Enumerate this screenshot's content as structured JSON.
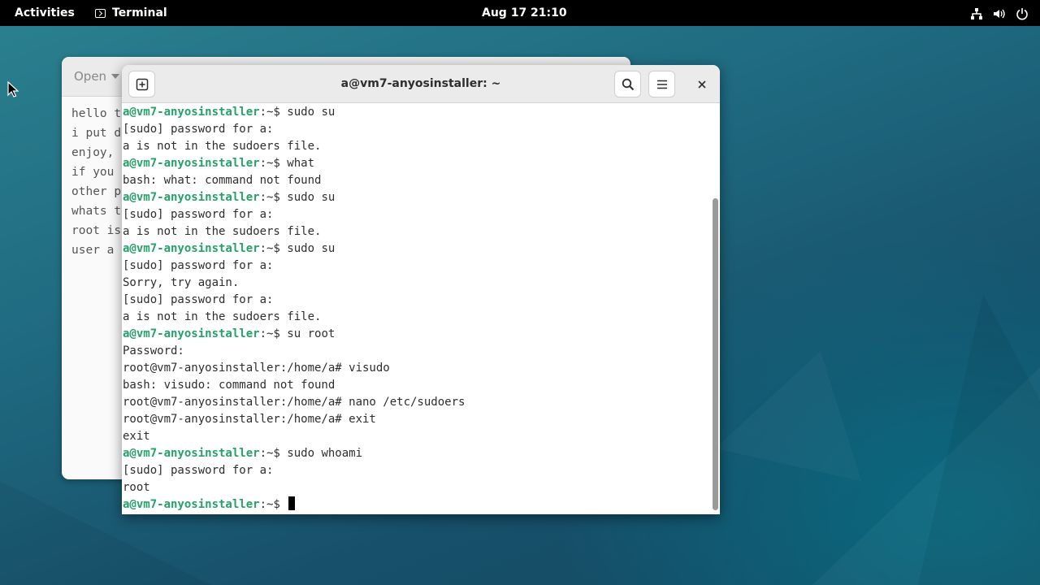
{
  "topbar": {
    "activities": "Activities",
    "app_name": "Terminal",
    "clock": "Aug 17  21:10"
  },
  "tray_icons": [
    "network-icon",
    "volume-icon",
    "power-icon"
  ],
  "editor": {
    "open_label": "Open",
    "lines": [
      "hello t",
      "i put d",
      "enjoy,",
      "if you",
      "other p",
      "whats t",
      "root is",
      "user a"
    ]
  },
  "terminal": {
    "title": "a@vm7-anyosinstaller: ~",
    "prompt_user": "a@vm7-anyosinstaller",
    "prompt_suffix": ":~$ ",
    "lines": [
      {
        "type": "prompt",
        "text": "sudo su"
      },
      {
        "type": "out",
        "text": "[sudo] password for a:"
      },
      {
        "type": "out",
        "text": "a is not in the sudoers file."
      },
      {
        "type": "prompt",
        "text": "what"
      },
      {
        "type": "out",
        "text": "bash: what: command not found"
      },
      {
        "type": "prompt",
        "text": "sudo su"
      },
      {
        "type": "out",
        "text": "[sudo] password for a:"
      },
      {
        "type": "out",
        "text": "a is not in the sudoers file."
      },
      {
        "type": "prompt",
        "text": "sudo su"
      },
      {
        "type": "out",
        "text": "[sudo] password for a:"
      },
      {
        "type": "out",
        "text": "Sorry, try again."
      },
      {
        "type": "out",
        "text": "[sudo] password for a:"
      },
      {
        "type": "out",
        "text": "a is not in the sudoers file."
      },
      {
        "type": "prompt",
        "text": "su root"
      },
      {
        "type": "out",
        "text": "Password:"
      },
      {
        "type": "out",
        "text": "root@vm7-anyosinstaller:/home/a# visudo"
      },
      {
        "type": "out",
        "text": "bash: visudo: command not found"
      },
      {
        "type": "out",
        "text": "root@vm7-anyosinstaller:/home/a# nano /etc/sudoers"
      },
      {
        "type": "out",
        "text": "root@vm7-anyosinstaller:/home/a# exit"
      },
      {
        "type": "out",
        "text": "exit"
      },
      {
        "type": "prompt",
        "text": "sudo whoami"
      },
      {
        "type": "out",
        "text": "[sudo] password for a:"
      },
      {
        "type": "out",
        "text": "root"
      },
      {
        "type": "prompt",
        "text": ""
      }
    ]
  },
  "colors": {
    "prompt_green": "#26a269",
    "topbar": "#000000",
    "desktop": "#1f6a80"
  }
}
